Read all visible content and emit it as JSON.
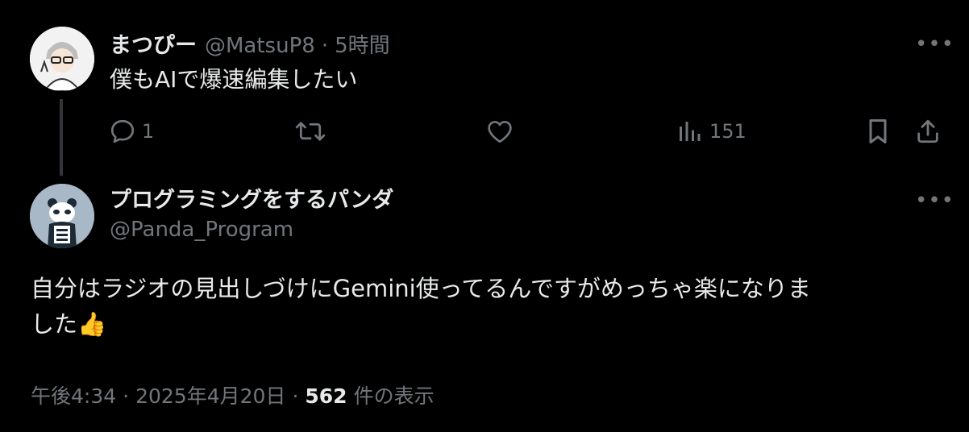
{
  "parent_tweet": {
    "name": "まつぴー",
    "handle": "@MatsuP8",
    "separator": "·",
    "time": "5時間",
    "text": "僕もAIで爆速編集したい",
    "replies": "1",
    "views": "151"
  },
  "reply_tweet": {
    "name": "プログラミングをするパンダ",
    "handle": "@Panda_Program",
    "text_line1": "自分はラジオの見出しづけにGemini使ってるんですがめっちゃ楽になりま",
    "text_line2": "した",
    "emoji": "👍",
    "time": "午後4:34",
    "sep1": "·",
    "date": "2025年4月20日",
    "sep2": "·",
    "view_count": "562",
    "view_label": "件の表示"
  },
  "icons": {
    "more": "more-horizontal-icon",
    "reply": "reply-bubble-icon",
    "retweet": "retweet-icon",
    "like": "heart-icon",
    "views": "views-bars-icon",
    "bookmark": "bookmark-icon",
    "share": "share-icon"
  },
  "colors": {
    "background": "#000000",
    "text": "#e7e9ea",
    "muted": "#71767b",
    "thread_line": "#333639"
  }
}
